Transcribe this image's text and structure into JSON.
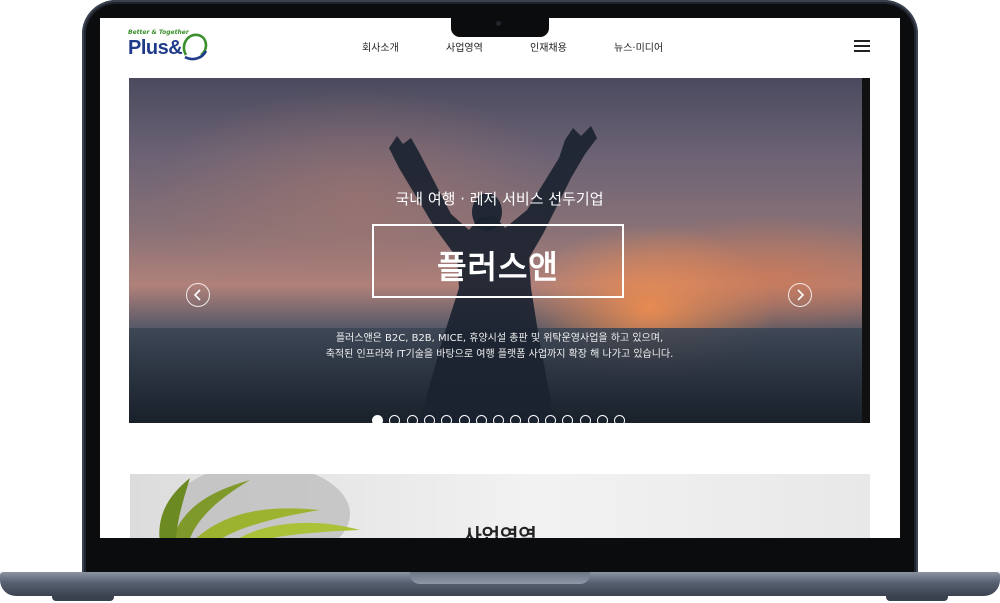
{
  "header": {
    "logo_tagline": "Better & Together",
    "logo_text": "Plus&",
    "nav": [
      "회사소개",
      "사업영역",
      "인재채용",
      "뉴스·미디어"
    ]
  },
  "hero": {
    "subtitle": "국내 여행 · 레저 서비스 선두기업",
    "title": "플러스앤",
    "desc_line1": "플러스앤은 B2C, B2B, MICE, 휴양시설 총판 및 위탁운영사업을 하고 있으며,",
    "desc_line2": "축적된 인프라와 IT기술을 바탕으로 여행 플랫폼 사업까지 확장 해 나가고 있습니다.",
    "slide_count": 15,
    "active_slide": 1
  },
  "business": {
    "section_title": "사업영역"
  },
  "colors": {
    "brand_blue": "#1f3b8a",
    "brand_green": "#3a8f2c"
  }
}
